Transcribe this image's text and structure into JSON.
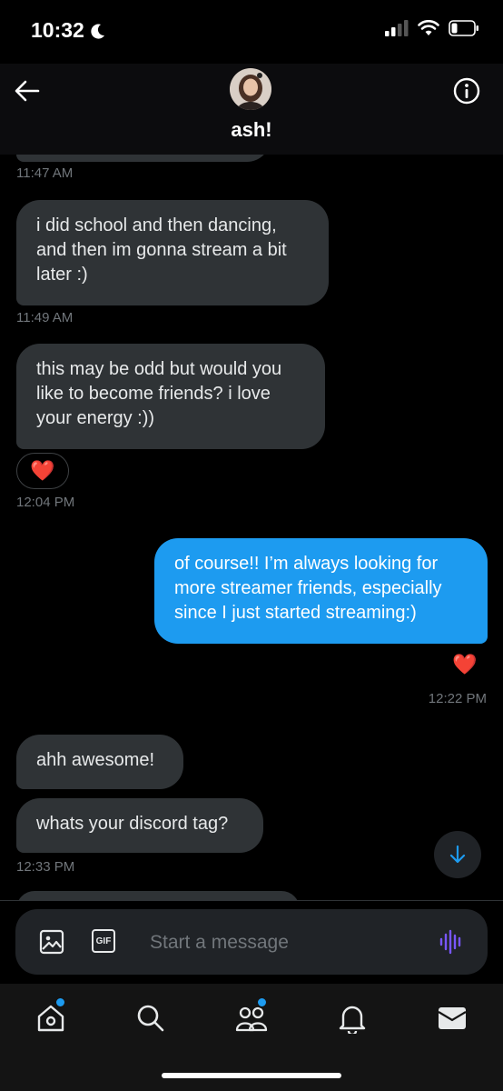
{
  "status_bar": {
    "time": "10:32"
  },
  "header": {
    "title": "ash!"
  },
  "messages": [
    {
      "id": "m1",
      "side": "received",
      "lines": [
        "i did school and then dancing,",
        "and then im gonna stream a bit",
        "later :)"
      ],
      "timestamp": "11:49 AM"
    },
    {
      "id": "m2",
      "side": "received",
      "lines": [
        "this may be odd but would you",
        "like to become friends? i love",
        "your energy :))"
      ],
      "reaction": "❤️",
      "timestamp": "12:04 PM"
    },
    {
      "id": "m3",
      "side": "sent",
      "lines": [
        "of course!! I’m always looking for",
        "more streamer friends, especially",
        "since I just started streaming:)"
      ],
      "reaction": "❤️",
      "timestamp": "12:22 PM"
    },
    {
      "id": "m4",
      "side": "received",
      "lines": [
        "ahh awesome!"
      ]
    },
    {
      "id": "m5",
      "side": "received",
      "lines": [
        "whats your discord tag?"
      ],
      "timestamp": "12:33 PM"
    }
  ],
  "earlier_timestamp": "11:47 AM",
  "composer": {
    "placeholder": "Start a message",
    "gif_label": "GIF"
  },
  "colors": {
    "sent_bubble": "#1d9bf0",
    "received_bubble": "#2f3336",
    "voice_accent": "#7856ff"
  },
  "tabs": [
    "home-icon",
    "search-icon",
    "communities-icon",
    "notifications-icon",
    "messages-icon"
  ]
}
